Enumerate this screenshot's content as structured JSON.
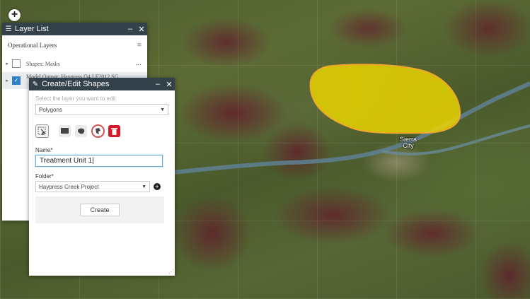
{
  "map": {
    "zoom_in_label": "+",
    "city_label_line1": "Sierra",
    "city_label_line2": "City",
    "polygon_fill": "#e8d400",
    "polygon_stroke": "#f0a82c",
    "river_color": "#5e7e8e"
  },
  "layer_list": {
    "title": "Layer List",
    "minimize": "–",
    "close": "✕",
    "section_title": "Operational Layers",
    "layers": [
      {
        "name": "Shapes: Masks",
        "checked": false
      },
      {
        "name": "Model Output: Haypress Q4 LF2012 SG",
        "checked": true
      }
    ]
  },
  "create_edit": {
    "title": "Create/Edit Shapes",
    "minimize": "–",
    "close": "✕",
    "layer_hint": "Select the layer you want to edit",
    "layer_value": "Polygons",
    "name_label": "Name*",
    "name_value": "Treatment Unit 1|",
    "folder_label": "Folder*",
    "folder_value": "Haypress Creek Project",
    "create_label": "Create",
    "tools": [
      "select-tool",
      "rectangle-tool",
      "polygon-tool",
      "freehand-tool",
      "delete-tool"
    ]
  },
  "colors": {
    "titlebar": "#33414a",
    "accent_blue": "#3081c8",
    "delete_red": "#d9182a"
  }
}
